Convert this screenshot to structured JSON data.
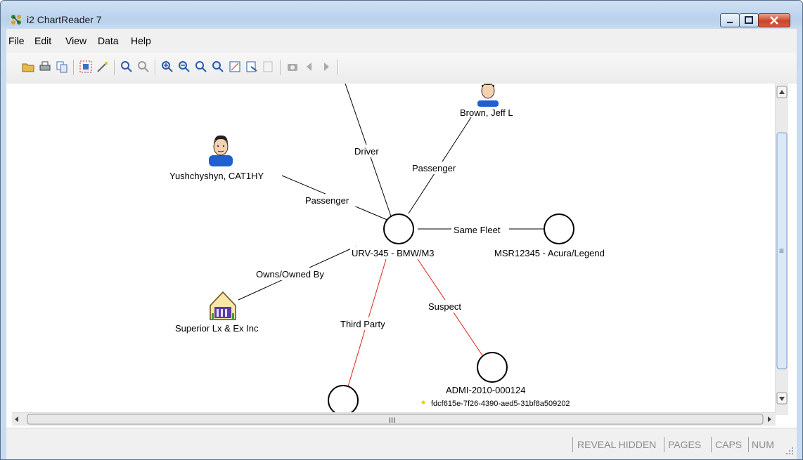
{
  "window": {
    "title": "i2 ChartReader 7"
  },
  "menu": [
    "File",
    "Edit",
    "View",
    "Data",
    "Help"
  ],
  "toolbar_icons": [
    "open-icon",
    "print-icon",
    "copy-icon",
    "select-icon",
    "magic-wand-icon",
    "find-icon",
    "find-next-icon",
    "zoom-in-icon",
    "zoom-out-icon",
    "zoom-select-icon",
    "zoom-fit-icon",
    "fit-width-icon",
    "fit-page-icon",
    "disabled-fit-icon",
    "snapshot-icon",
    "back-icon",
    "forward-icon"
  ],
  "chart": {
    "entities": [
      {
        "id": "bmw",
        "label": "URV-345 - BMW/M3",
        "kind": "circle"
      },
      {
        "id": "acura",
        "label": "MSR12345 - Acura/Legend",
        "kind": "circle"
      },
      {
        "id": "admi",
        "label": "ADMI-2010-000124",
        "sublabel": "fdcf615e-7f26-4390-aed5-31bf8a509202",
        "kind": "circle"
      },
      {
        "id": "third",
        "label": "",
        "kind": "circle"
      },
      {
        "id": "brown",
        "label": "Brown, Jeff L",
        "kind": "person"
      },
      {
        "id": "yush",
        "label": "Yushchyshyn, CAT1HY",
        "kind": "person"
      },
      {
        "id": "superior",
        "label": "Superior Lx & Ex Inc",
        "kind": "organization"
      }
    ],
    "links": [
      {
        "label": "Driver",
        "color": "#000000"
      },
      {
        "label": "Passenger",
        "color": "#000000"
      },
      {
        "label": "Passenger",
        "color": "#000000"
      },
      {
        "label": "Same Fleet",
        "color": "#000000"
      },
      {
        "label": "Owns/Owned By",
        "color": "#000000"
      },
      {
        "label": "Third Party",
        "color": "#e02020"
      },
      {
        "label": "Suspect",
        "color": "#e02020"
      }
    ]
  },
  "scrollbars": {
    "h_grip": "III",
    "v_grip": "≡"
  },
  "status": [
    "REVEAL HIDDEN",
    "PAGES",
    "CAPS",
    "NUM"
  ]
}
